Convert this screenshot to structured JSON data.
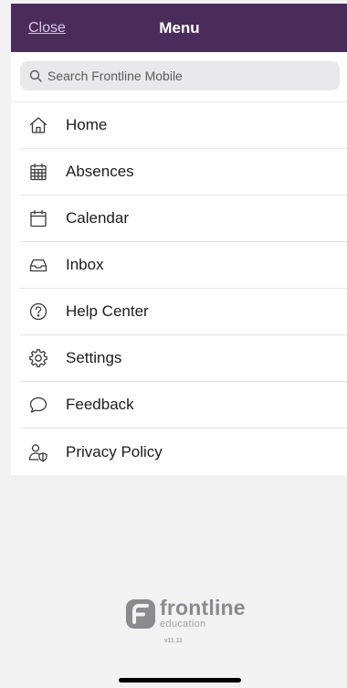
{
  "header": {
    "close_label": "Close",
    "title": "Menu"
  },
  "search": {
    "placeholder": "Search Frontline Mobile",
    "value": ""
  },
  "menu": {
    "items": [
      {
        "label": "Home",
        "icon": "home-icon"
      },
      {
        "label": "Absences",
        "icon": "calendar-grid-icon"
      },
      {
        "label": "Calendar",
        "icon": "calendar-icon"
      },
      {
        "label": "Inbox",
        "icon": "inbox-icon"
      },
      {
        "label": "Help Center",
        "icon": "help-circle-icon"
      },
      {
        "label": "Settings",
        "icon": "gear-icon"
      },
      {
        "label": "Feedback",
        "icon": "chat-bubble-icon"
      },
      {
        "label": "Privacy Policy",
        "icon": "user-shield-icon"
      }
    ]
  },
  "footer": {
    "brand_word": "frontline",
    "brand_sub": "education",
    "version": "v11.11"
  },
  "colors": {
    "header_bg": "#4a2c5b",
    "page_bg": "#f2f2f2",
    "logo_gray": "#8a8a8f"
  }
}
